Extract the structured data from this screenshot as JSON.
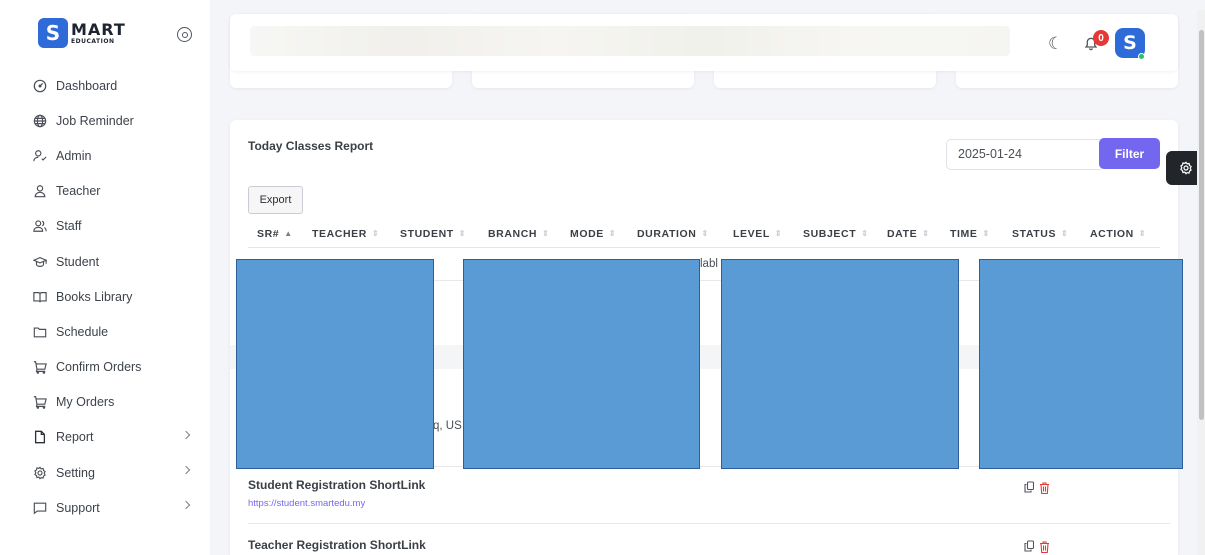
{
  "brand": {
    "logo_letter": "S",
    "name": "MART",
    "tagline": "EDUCATION"
  },
  "sidebar": {
    "items": [
      {
        "label": "Dashboard",
        "icon": "dashboard-icon"
      },
      {
        "label": "Job Reminder",
        "icon": "globe-icon"
      },
      {
        "label": "Admin",
        "icon": "user-check-icon"
      },
      {
        "label": "Teacher",
        "icon": "user-icon"
      },
      {
        "label": "Staff",
        "icon": "users-icon"
      },
      {
        "label": "Student",
        "icon": "graduation-cap-icon"
      },
      {
        "label": "Books Library",
        "icon": "book-open-icon"
      },
      {
        "label": "Schedule",
        "icon": "folder-icon"
      },
      {
        "label": "Confirm Orders",
        "icon": "cart-icon"
      },
      {
        "label": "My Orders",
        "icon": "cart-icon"
      },
      {
        "label": "Report",
        "icon": "file-icon"
      },
      {
        "label": "Setting",
        "icon": "gear-icon"
      },
      {
        "label": "Support",
        "icon": "message-icon"
      }
    ]
  },
  "topbar": {
    "notification_count": "0",
    "avatar_letter": "S"
  },
  "report": {
    "title": "Today Classes Report",
    "date_value": "2025-01-24",
    "filter_label": "Filter",
    "export_label": "Export",
    "columns": [
      "SR#",
      "TEACHER",
      "STUDENT",
      "BRANCH",
      "MODE",
      "DURATION",
      "LEVEL",
      "SUBJECT",
      "DATE",
      "TIME",
      "STATUS",
      "ACTION"
    ],
    "visible_fragments": {
      "row_text": "labl",
      "address_text": "q, US"
    }
  },
  "shortlinks": [
    {
      "title": "Student Registration ShortLink",
      "url": "https://student.smartedu.my"
    },
    {
      "title": "Teacher Registration ShortLink",
      "url": ""
    }
  ],
  "colors": {
    "accent": "#7367f0",
    "brand": "#2e6bd8",
    "redaction": "#5b9bd5",
    "danger": "#e53935"
  }
}
